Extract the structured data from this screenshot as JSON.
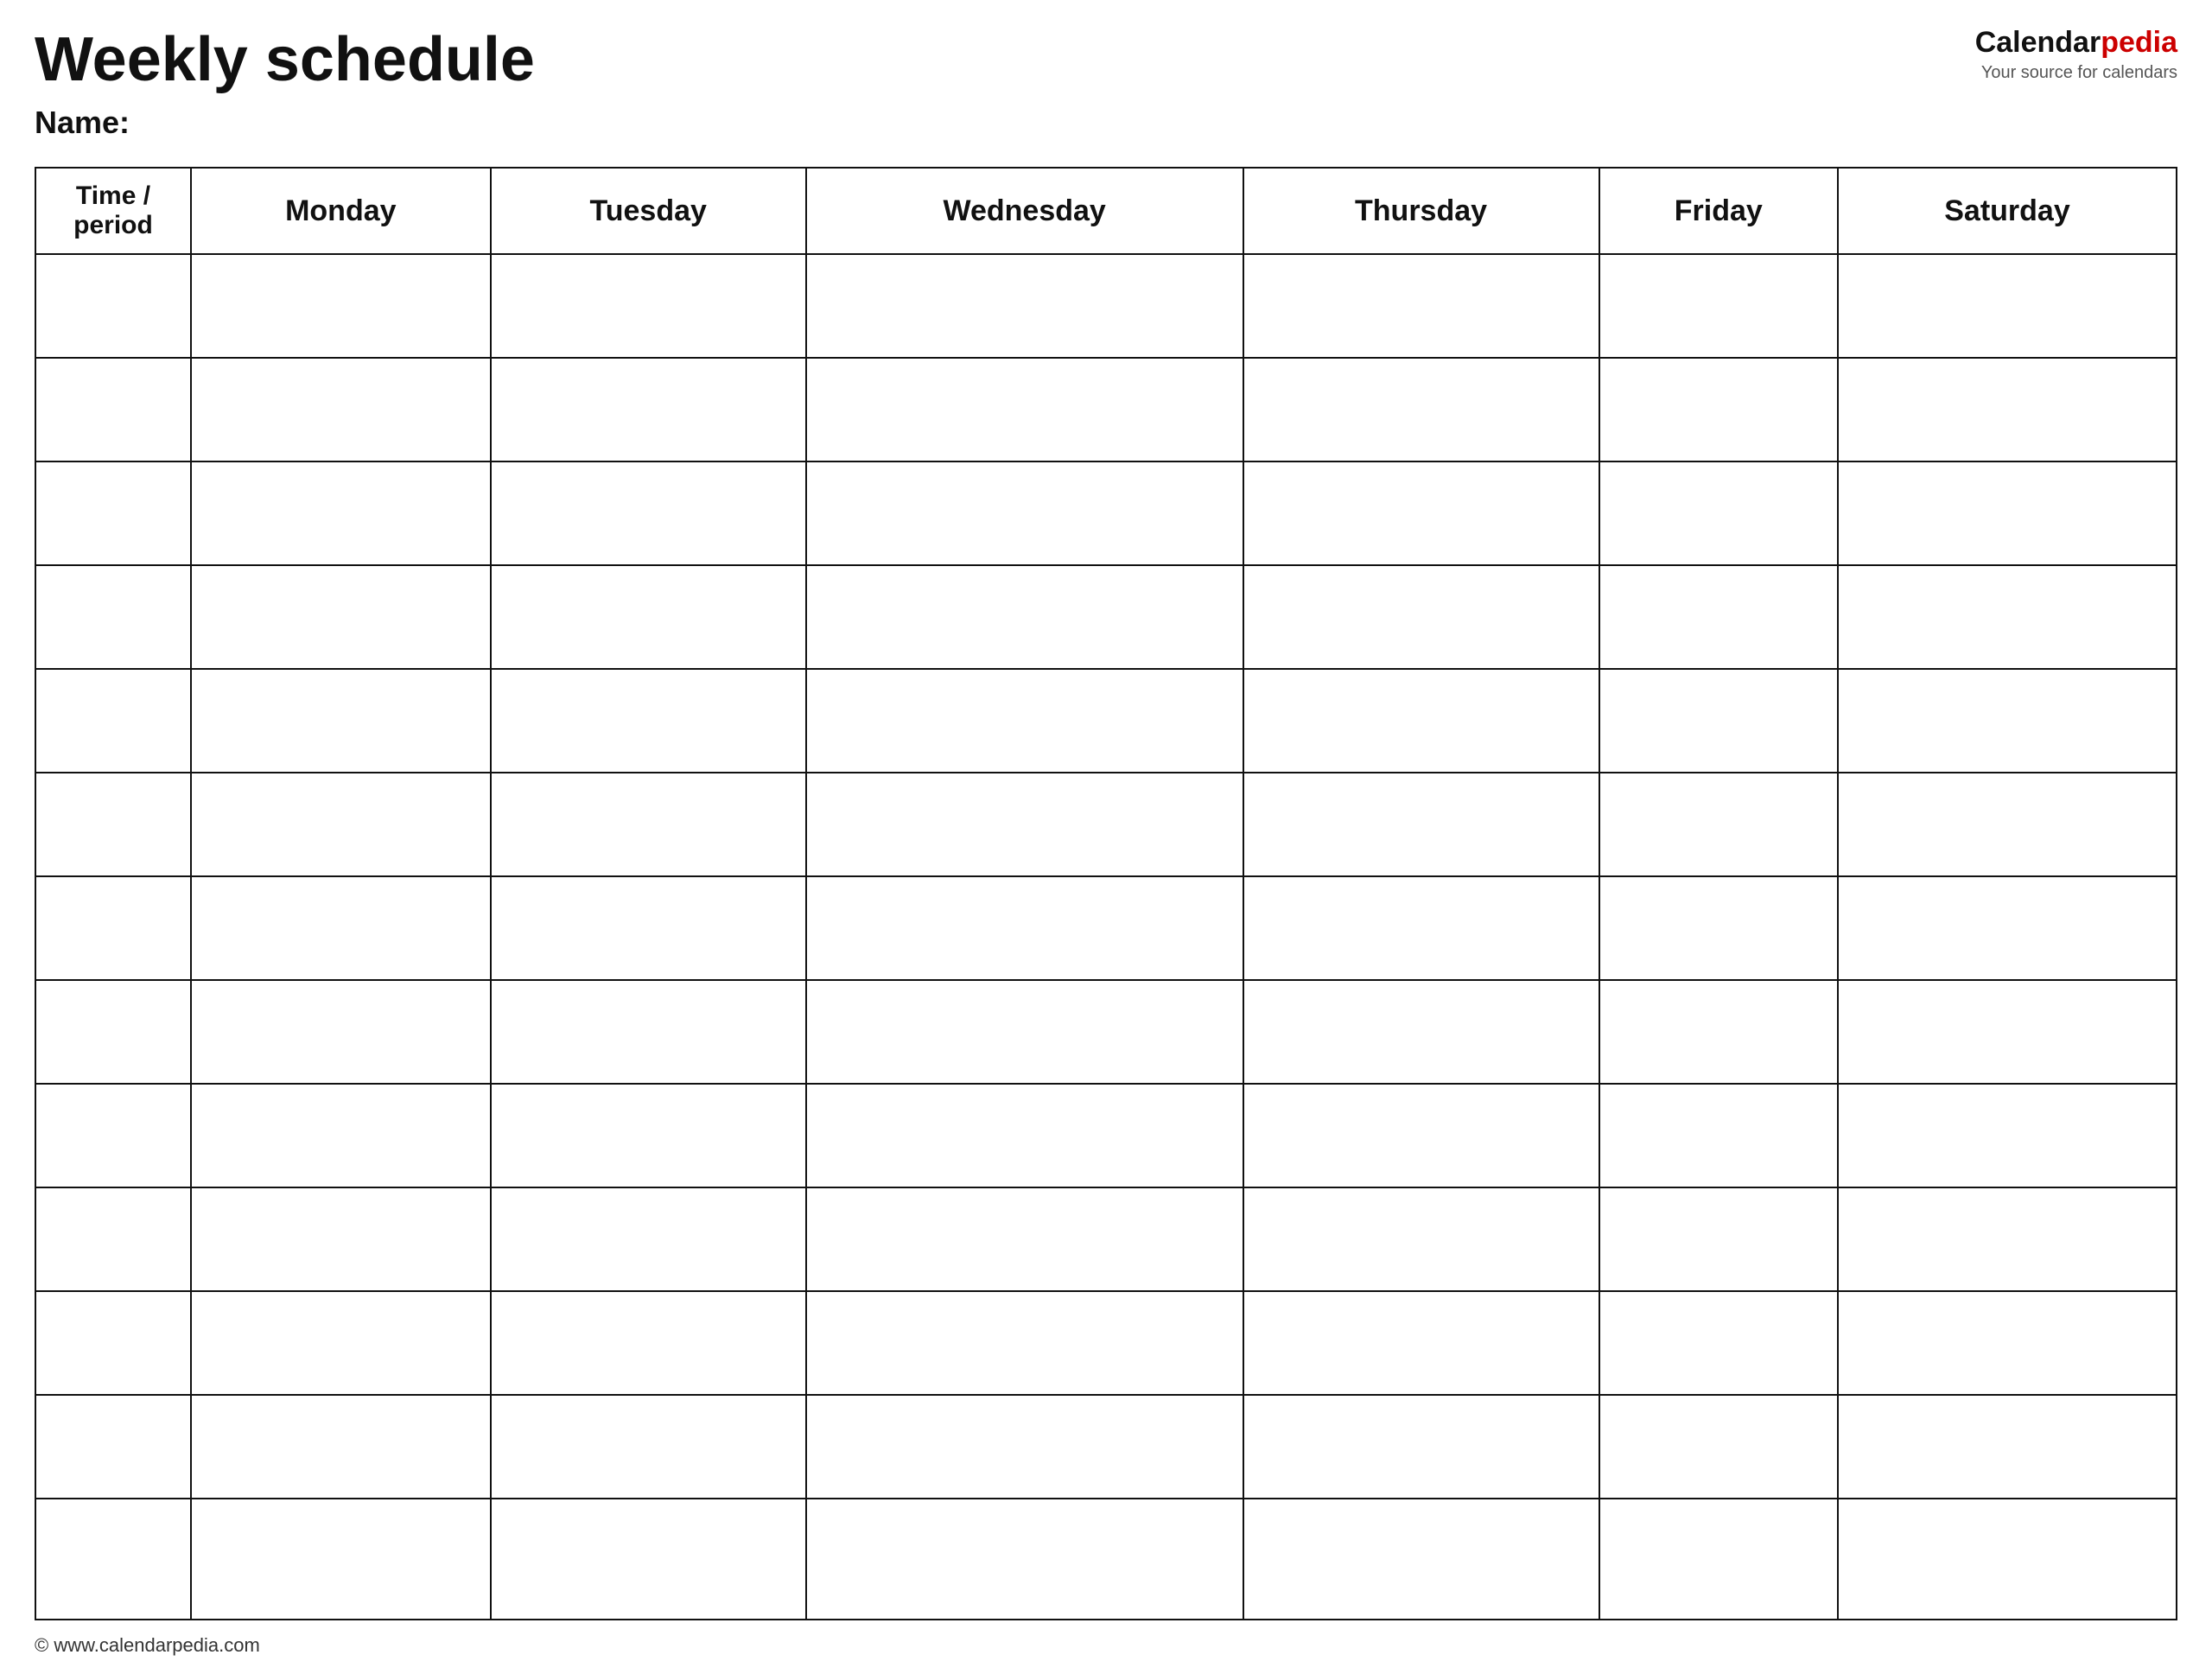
{
  "header": {
    "title": "Weekly schedule",
    "name_label": "Name:",
    "logo": {
      "text_black": "Calendar",
      "text_red": "pedia",
      "tagline": "Your source for calendars"
    }
  },
  "table": {
    "columns": [
      {
        "key": "time",
        "label": "Time / period"
      },
      {
        "key": "monday",
        "label": "Monday"
      },
      {
        "key": "tuesday",
        "label": "Tuesday"
      },
      {
        "key": "wednesday",
        "label": "Wednesday"
      },
      {
        "key": "thursday",
        "label": "Thursday"
      },
      {
        "key": "friday",
        "label": "Friday"
      },
      {
        "key": "saturday",
        "label": "Saturday"
      }
    ],
    "row_count": 13
  },
  "footer": {
    "url": "© www.calendarpedia.com"
  }
}
